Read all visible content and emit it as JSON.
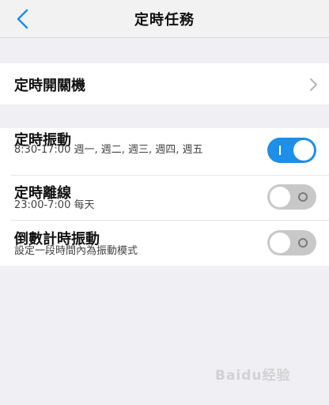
{
  "header": {
    "title": "定時任務",
    "back_icon": "chevron-left-icon"
  },
  "timer_power": {
    "label": "定時開關機",
    "chevron_icon": "chevron-right-icon"
  },
  "timed_vibration": {
    "label": "定時振動",
    "schedule": "8:30-17:00 週一, 週二, 週三, 週四, 週五",
    "enabled": true
  },
  "timed_offline": {
    "label": "定時離線",
    "schedule": "23:00-7:00 每天",
    "enabled": false
  },
  "countdown_vibration": {
    "label": "倒數計時振動",
    "description": "設定一段時間內為振動模式",
    "enabled": false
  },
  "colors": {
    "accent": "#1e8fe8",
    "toggle_off": "#c8c8c8",
    "background": "#efeff4"
  },
  "watermark": {
    "text": "Baidu经验"
  }
}
